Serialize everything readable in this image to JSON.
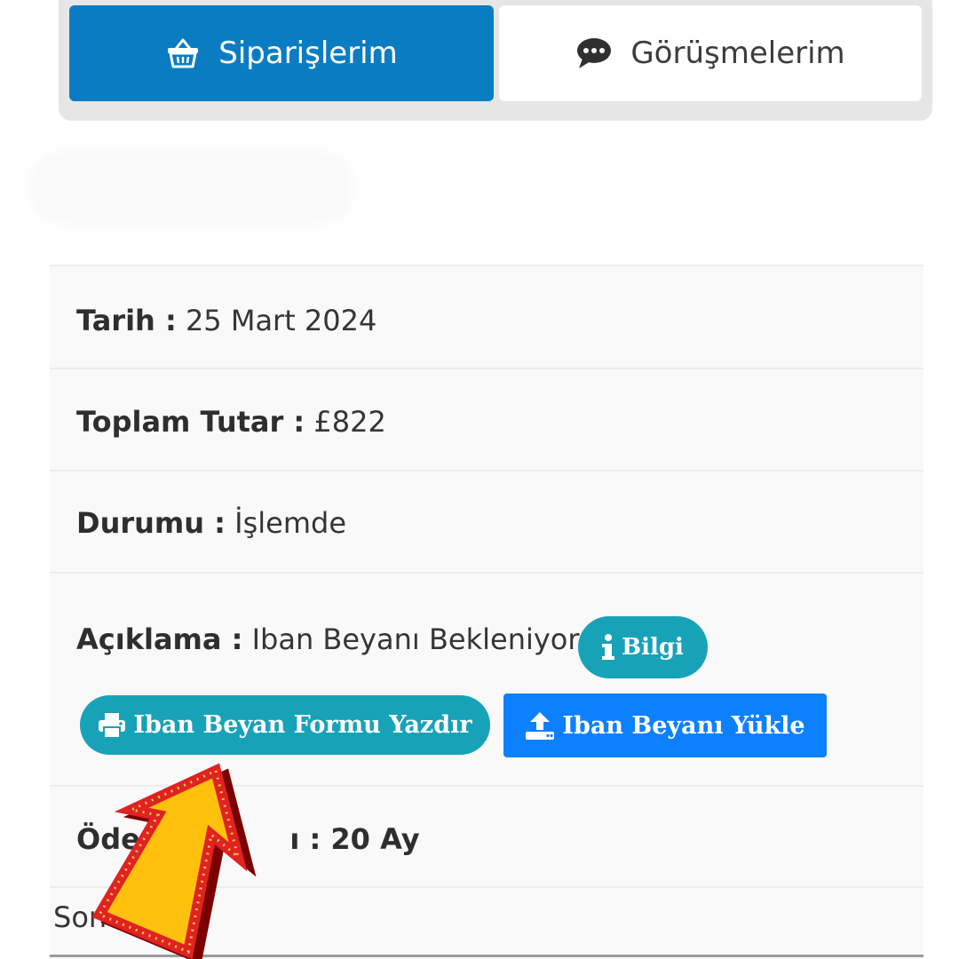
{
  "tabs": {
    "orders": {
      "label": "Siparişlerim",
      "icon": "basket-icon"
    },
    "chats": {
      "label": "Görüşmelerim",
      "icon": "chat-bubble-icon"
    }
  },
  "order": {
    "date": {
      "label": "Tarih :",
      "value": "25 Mart 2024"
    },
    "total": {
      "label": "Toplam Tutar :",
      "value": "£822"
    },
    "status": {
      "label": "Durumu :",
      "value": "İşlemde"
    },
    "description": {
      "label": "Açıklama :",
      "value": "Iban Beyanı Bekleniyor",
      "info_button": "Bilgi",
      "print_button": "Iban Beyan Formu Yazdır",
      "upload_button": "Iban Beyanı Yükle"
    },
    "payment": {
      "label_visible": "Öde",
      "label_hidden_tail": "...",
      "value": "ı : 20 Ay"
    },
    "last_row": {
      "text": "Sonuç"
    }
  },
  "icons": [
    "basket-icon",
    "chat-bubble-icon",
    "info-icon",
    "printer-icon",
    "upload-icon",
    "pointer-arrow-icon"
  ],
  "colors": {
    "tab_active": "#0a7dc2",
    "info_button": "#17a2b8",
    "upload_button": "#0d80ff",
    "arrow_fill": "#ffc107",
    "arrow_border": "#e02020"
  }
}
